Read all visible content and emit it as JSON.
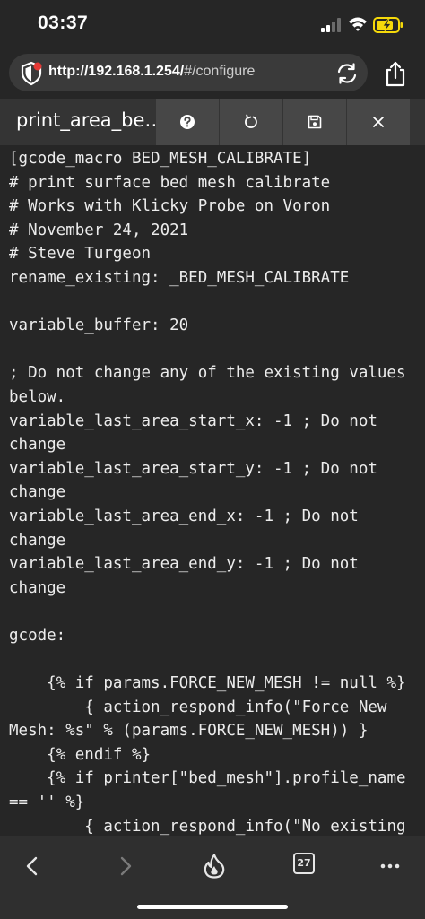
{
  "status_bar": {
    "time": "03:37",
    "icons": [
      "cellular-signal-icon",
      "wifi-icon",
      "battery-charging-icon"
    ]
  },
  "address_bar": {
    "url_host": "http://192.168.1.254/",
    "url_path": "#/configure",
    "icons": [
      "privacy-shield-icon",
      "reload-icon",
      "share-icon"
    ]
  },
  "editor_header": {
    "file_title": "print_area_be…",
    "buttons": [
      {
        "name": "help",
        "icon": "help-icon"
      },
      {
        "name": "restart",
        "icon": "restart-icon"
      },
      {
        "name": "save",
        "icon": "save-icon"
      },
      {
        "name": "close",
        "icon": "close-icon"
      }
    ]
  },
  "code": {
    "lines": [
      "[gcode_macro BED_MESH_CALIBRATE]",
      "# print surface bed mesh calibrate",
      "# Works with Klicky Probe on Voron",
      "# November 24, 2021",
      "# Steve Turgeon",
      "rename_existing: _BED_MESH_CALIBRATE",
      "",
      "variable_buffer: 20",
      "",
      "; Do not change any of the existing values below.",
      "variable_last_area_start_x: -1 ; Do not change",
      "variable_last_area_start_y: -1 ; Do not change",
      "variable_last_area_end_x: -1 ; Do not change",
      "variable_last_area_end_y: -1 ; Do not change",
      "",
      "gcode:",
      "",
      "    {% if params.FORCE_NEW_MESH != null %}",
      "        { action_respond_info(\"Force New Mesh: %s\" % (params.FORCE_NEW_MESH)) }",
      "    {% endif %}",
      "    {% if printer[\"bed_mesh\"].profile_name == '' %}",
      "        { action_respond_info(\"No existing"
    ]
  },
  "bottom_toolbar": {
    "tab_count": "27",
    "icons": [
      "back-icon",
      "forward-icon",
      "fire-icon",
      "tabs-icon",
      "more-icon"
    ]
  },
  "colors": {
    "background": "#262626",
    "header_bar": "#343434",
    "header_button": "#474747",
    "url_pill": "#3a3a3a",
    "toolbar": "#2f2f2f",
    "text": "#ececec",
    "battery_fill": "#f5d90a",
    "shield_badge": "#e53935"
  }
}
